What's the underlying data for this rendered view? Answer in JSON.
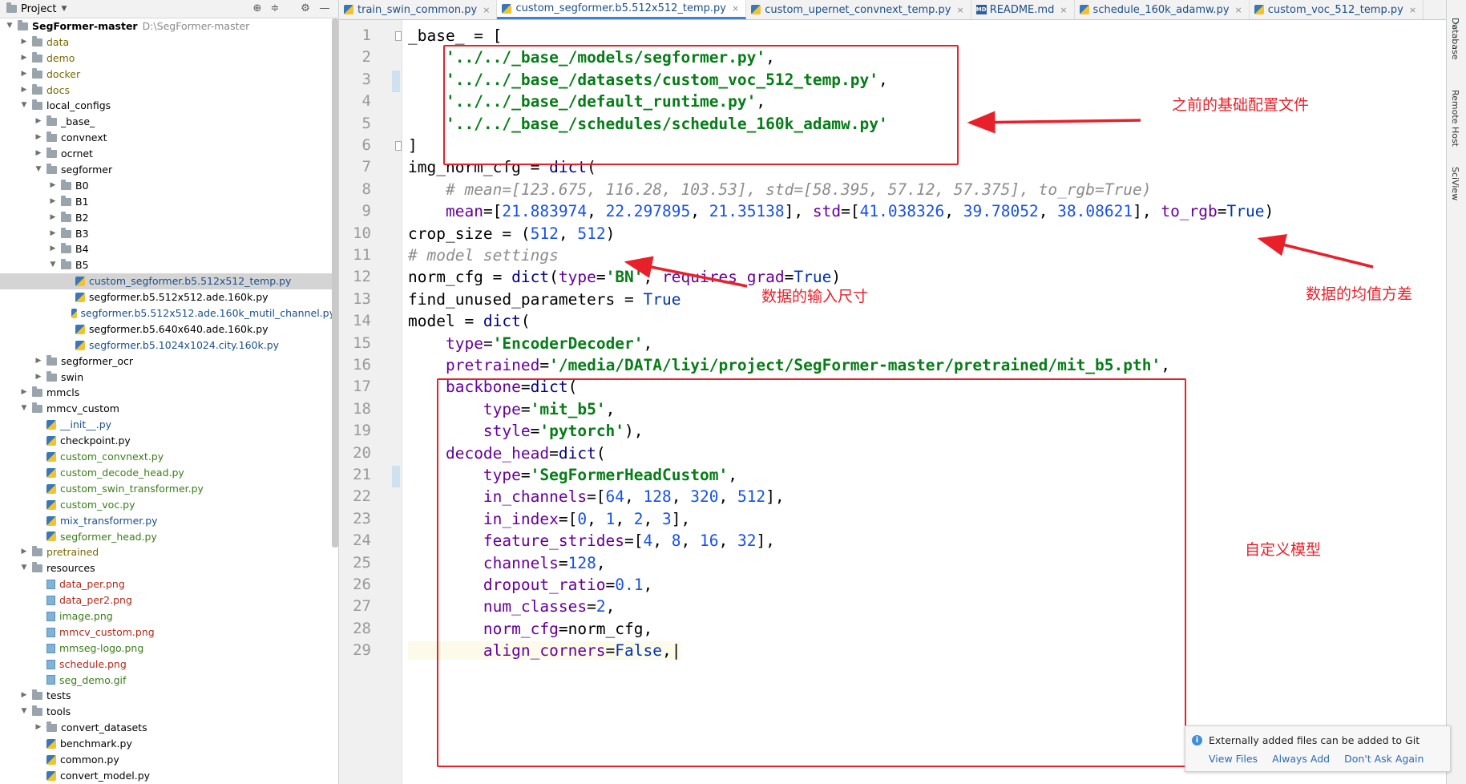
{
  "project": {
    "title": "Project",
    "tree": [
      {
        "label": "SegFormer-master",
        "hint": "D:\\SegFormer-master",
        "indent": 0,
        "type": "folder",
        "state": "open",
        "root": true
      },
      {
        "label": "data",
        "indent": 1,
        "type": "folder",
        "state": "closed",
        "color": "#7a6a00"
      },
      {
        "label": "demo",
        "indent": 1,
        "type": "folder",
        "state": "closed",
        "color": "#7a6a00"
      },
      {
        "label": "docker",
        "indent": 1,
        "type": "folder",
        "state": "closed",
        "color": "#7a6a00"
      },
      {
        "label": "docs",
        "indent": 1,
        "type": "folder",
        "state": "closed",
        "color": "#7a6a00"
      },
      {
        "label": "local_configs",
        "indent": 1,
        "type": "folder",
        "state": "open",
        "color": "#000000"
      },
      {
        "label": "_base_",
        "indent": 2,
        "type": "folder",
        "state": "closed",
        "color": "#000000"
      },
      {
        "label": "convnext",
        "indent": 2,
        "type": "folder",
        "state": "closed",
        "color": "#000000"
      },
      {
        "label": "ocrnet",
        "indent": 2,
        "type": "folder",
        "state": "closed",
        "color": "#000000"
      },
      {
        "label": "segformer",
        "indent": 2,
        "type": "folder",
        "state": "open",
        "color": "#000000"
      },
      {
        "label": "B0",
        "indent": 3,
        "type": "folder",
        "state": "closed",
        "color": "#000000"
      },
      {
        "label": "B1",
        "indent": 3,
        "type": "folder",
        "state": "closed",
        "color": "#000000"
      },
      {
        "label": "B2",
        "indent": 3,
        "type": "folder",
        "state": "closed",
        "color": "#000000"
      },
      {
        "label": "B3",
        "indent": 3,
        "type": "folder",
        "state": "closed",
        "color": "#000000"
      },
      {
        "label": "B4",
        "indent": 3,
        "type": "folder",
        "state": "closed",
        "color": "#000000"
      },
      {
        "label": "B5",
        "indent": 3,
        "type": "folder",
        "state": "open",
        "color": "#000000"
      },
      {
        "label": "custom_segformer.b5.512x512_temp.py",
        "indent": 4,
        "type": "py",
        "color": "#1a4f8b",
        "selected": true
      },
      {
        "label": "segformer.b5.512x512.ade.160k.py",
        "indent": 4,
        "type": "py",
        "color": "#000000"
      },
      {
        "label": "segformer.b5.512x512.ade.160k_mutil_channel.py",
        "indent": 4,
        "type": "py",
        "color": "#1a4f8b"
      },
      {
        "label": "segformer.b5.640x640.ade.160k.py",
        "indent": 4,
        "type": "py",
        "color": "#000000"
      },
      {
        "label": "segformer.b5.1024x1024.city.160k.py",
        "indent": 4,
        "type": "py",
        "color": "#1a4f8b"
      },
      {
        "label": "segformer_ocr",
        "indent": 2,
        "type": "folder",
        "state": "closed",
        "color": "#000000"
      },
      {
        "label": "swin",
        "indent": 2,
        "type": "folder",
        "state": "closed",
        "color": "#000000"
      },
      {
        "label": "mmcls",
        "indent": 1,
        "type": "folder",
        "state": "closed",
        "color": "#000000"
      },
      {
        "label": "mmcv_custom",
        "indent": 1,
        "type": "folder",
        "state": "open",
        "color": "#000000"
      },
      {
        "label": "__init__.py",
        "indent": 2,
        "type": "py",
        "color": "#1a4f8b"
      },
      {
        "label": "checkpoint.py",
        "indent": 2,
        "type": "py",
        "color": "#000000"
      },
      {
        "label": "custom_convnext.py",
        "indent": 2,
        "type": "py",
        "color": "#3a7d1a"
      },
      {
        "label": "custom_decode_head.py",
        "indent": 2,
        "type": "py",
        "color": "#3a7d1a"
      },
      {
        "label": "custom_swin_transformer.py",
        "indent": 2,
        "type": "py",
        "color": "#3a7d1a"
      },
      {
        "label": "custom_voc.py",
        "indent": 2,
        "type": "py",
        "color": "#3a7d1a"
      },
      {
        "label": "mix_transformer.py",
        "indent": 2,
        "type": "py",
        "color": "#1a4f8b"
      },
      {
        "label": "segformer_head.py",
        "indent": 2,
        "type": "py",
        "color": "#3a7d1a"
      },
      {
        "label": "pretrained",
        "indent": 1,
        "type": "folder",
        "state": "closed",
        "color": "#7a6a00"
      },
      {
        "label": "resources",
        "indent": 1,
        "type": "folder",
        "state": "open",
        "color": "#000000"
      },
      {
        "label": "data_per.png",
        "indent": 2,
        "type": "img",
        "color": "#b02a1a"
      },
      {
        "label": "data_per2.png",
        "indent": 2,
        "type": "img",
        "color": "#b02a1a"
      },
      {
        "label": "image.png",
        "indent": 2,
        "type": "img",
        "color": "#3a7d1a"
      },
      {
        "label": "mmcv_custom.png",
        "indent": 2,
        "type": "img",
        "color": "#b02a1a"
      },
      {
        "label": "mmseg-logo.png",
        "indent": 2,
        "type": "img",
        "color": "#3a7d1a"
      },
      {
        "label": "schedule.png",
        "indent": 2,
        "type": "img",
        "color": "#b02a1a"
      },
      {
        "label": "seg_demo.gif",
        "indent": 2,
        "type": "img",
        "color": "#3a7d1a"
      },
      {
        "label": "tests",
        "indent": 1,
        "type": "folder",
        "state": "closed",
        "color": "#000000"
      },
      {
        "label": "tools",
        "indent": 1,
        "type": "folder",
        "state": "open",
        "color": "#000000"
      },
      {
        "label": "convert_datasets",
        "indent": 2,
        "type": "folder",
        "state": "closed",
        "color": "#000000"
      },
      {
        "label": "benchmark.py",
        "indent": 2,
        "type": "py",
        "color": "#000000"
      },
      {
        "label": "common.py",
        "indent": 2,
        "type": "py",
        "color": "#000000"
      },
      {
        "label": "convert_model.py",
        "indent": 2,
        "type": "py",
        "color": "#000000"
      }
    ]
  },
  "tabs": [
    {
      "label": "train_swin_common.py",
      "active": false,
      "icon": "py"
    },
    {
      "label": "custom_segformer.b5.512x512_temp.py",
      "active": true,
      "icon": "py"
    },
    {
      "label": "custom_upernet_convnext_temp.py",
      "active": false,
      "icon": "py"
    },
    {
      "label": "README.md",
      "active": false,
      "icon": "md"
    },
    {
      "label": "schedule_160k_adamw.py",
      "active": false,
      "icon": "py"
    },
    {
      "label": "custom_voc_512_temp.py",
      "active": false,
      "icon": "py"
    }
  ],
  "code": [
    [
      [
        "",
        "_base_ = ["
      ]
    ],
    [
      [
        "",
        "    "
      ],
      [
        "str",
        "'../../_base_/models/segformer.py'"
      ],
      [
        "",
        ","
      ]
    ],
    [
      [
        "",
        "    "
      ],
      [
        "str",
        "'../../_base_/datasets/custom_voc_512_temp.py'"
      ],
      [
        "",
        ","
      ]
    ],
    [
      [
        "",
        "    "
      ],
      [
        "str",
        "'../../_base_/default_runtime.py'"
      ],
      [
        "",
        ","
      ]
    ],
    [
      [
        "",
        "    "
      ],
      [
        "str",
        "'../../_base_/schedules/schedule_160k_adamw.py'"
      ]
    ],
    [
      [
        "",
        "]"
      ]
    ],
    [
      [
        "",
        "img_norm_cfg = "
      ],
      [
        "builtin",
        "dict"
      ],
      [
        "",
        "("
      ]
    ],
    [
      [
        "",
        "    "
      ],
      [
        "com",
        "# mean=[123.675, 116.28, 103.53], std=[58.395, 57.12, 57.375], to_rgb=True)"
      ]
    ],
    [
      [
        "",
        "    "
      ],
      [
        "param",
        "mean"
      ],
      [
        "",
        "=["
      ],
      [
        "num",
        "21.883974"
      ],
      [
        "",
        ", "
      ],
      [
        "num",
        "22.297895"
      ],
      [
        "",
        ", "
      ],
      [
        "num",
        "21.35138"
      ],
      [
        "",
        "], "
      ],
      [
        "param",
        "std"
      ],
      [
        "",
        "=["
      ],
      [
        "num",
        "41.038326"
      ],
      [
        "",
        ", "
      ],
      [
        "num",
        "39.78052"
      ],
      [
        "",
        ", "
      ],
      [
        "num",
        "38.08621"
      ],
      [
        "",
        "], "
      ],
      [
        "param",
        "to_rgb"
      ],
      [
        "",
        "="
      ],
      [
        "bool",
        "True"
      ],
      [
        "",
        ")"
      ]
    ],
    [
      [
        "",
        "crop_size = ("
      ],
      [
        "num",
        "512"
      ],
      [
        "",
        ", "
      ],
      [
        "num",
        "512"
      ],
      [
        "",
        ")"
      ]
    ],
    [
      [
        "com",
        "# model settings"
      ]
    ],
    [
      [
        "",
        "norm_cfg = "
      ],
      [
        "builtin",
        "dict"
      ],
      [
        "",
        "("
      ],
      [
        "param",
        "type"
      ],
      [
        "",
        "="
      ],
      [
        "str",
        "'BN'"
      ],
      [
        "",
        ", "
      ],
      [
        "param",
        "requires_grad"
      ],
      [
        "",
        "="
      ],
      [
        "bool",
        "True"
      ],
      [
        "",
        ")"
      ]
    ],
    [
      [
        "",
        "find_unused_parameters = "
      ],
      [
        "bool",
        "True"
      ]
    ],
    [
      [
        "",
        "model = "
      ],
      [
        "builtin",
        "dict"
      ],
      [
        "",
        "("
      ]
    ],
    [
      [
        "",
        "    "
      ],
      [
        "param",
        "type"
      ],
      [
        "",
        "="
      ],
      [
        "str",
        "'EncoderDecoder'"
      ],
      [
        "",
        ","
      ]
    ],
    [
      [
        "",
        "    "
      ],
      [
        "param",
        "pretrained"
      ],
      [
        "",
        "="
      ],
      [
        "str",
        "'/media/DATA/liyi/project/SegFormer-master/pretrained/mit_b5.pth'"
      ],
      [
        "",
        ","
      ]
    ],
    [
      [
        "",
        "    "
      ],
      [
        "param",
        "backbone"
      ],
      [
        "",
        "="
      ],
      [
        "builtin",
        "dict"
      ],
      [
        "",
        "("
      ]
    ],
    [
      [
        "",
        "        "
      ],
      [
        "param",
        "type"
      ],
      [
        "",
        "="
      ],
      [
        "str",
        "'mit_b5'"
      ],
      [
        "",
        ","
      ]
    ],
    [
      [
        "",
        "        "
      ],
      [
        "param",
        "style"
      ],
      [
        "",
        "="
      ],
      [
        "str",
        "'pytorch'"
      ],
      [
        "",
        "),"
      ]
    ],
    [
      [
        "",
        "    "
      ],
      [
        "param",
        "decode_head"
      ],
      [
        "",
        "="
      ],
      [
        "builtin",
        "dict"
      ],
      [
        "",
        "("
      ]
    ],
    [
      [
        "",
        "        "
      ],
      [
        "param",
        "type"
      ],
      [
        "",
        "="
      ],
      [
        "str",
        "'SegFormerHeadCustom'"
      ],
      [
        "",
        ","
      ]
    ],
    [
      [
        "",
        "        "
      ],
      [
        "param",
        "in_channels"
      ],
      [
        "",
        "=["
      ],
      [
        "num",
        "64"
      ],
      [
        "",
        ", "
      ],
      [
        "num",
        "128"
      ],
      [
        "",
        ", "
      ],
      [
        "num",
        "320"
      ],
      [
        "",
        ", "
      ],
      [
        "num",
        "512"
      ],
      [
        "",
        "],"
      ]
    ],
    [
      [
        "",
        "        "
      ],
      [
        "param",
        "in_index"
      ],
      [
        "",
        "=["
      ],
      [
        "num",
        "0"
      ],
      [
        "",
        ", "
      ],
      [
        "num",
        "1"
      ],
      [
        "",
        ", "
      ],
      [
        "num",
        "2"
      ],
      [
        "",
        ", "
      ],
      [
        "num",
        "3"
      ],
      [
        "",
        "],"
      ]
    ],
    [
      [
        "",
        "        "
      ],
      [
        "param",
        "feature_strides"
      ],
      [
        "",
        "=["
      ],
      [
        "num",
        "4"
      ],
      [
        "",
        ", "
      ],
      [
        "num",
        "8"
      ],
      [
        "",
        ", "
      ],
      [
        "num",
        "16"
      ],
      [
        "",
        ", "
      ],
      [
        "num",
        "32"
      ],
      [
        "",
        "],"
      ]
    ],
    [
      [
        "",
        "        "
      ],
      [
        "param",
        "channels"
      ],
      [
        "",
        "="
      ],
      [
        "num",
        "128"
      ],
      [
        "",
        ","
      ]
    ],
    [
      [
        "",
        "        "
      ],
      [
        "param",
        "dropout_ratio"
      ],
      [
        "",
        "="
      ],
      [
        "num",
        "0.1"
      ],
      [
        "",
        ","
      ]
    ],
    [
      [
        "",
        "        "
      ],
      [
        "param",
        "num_classes"
      ],
      [
        "",
        "="
      ],
      [
        "num",
        "2"
      ],
      [
        "",
        ","
      ]
    ],
    [
      [
        "",
        "        "
      ],
      [
        "param",
        "norm_cfg"
      ],
      [
        "",
        "=norm_cfg,"
      ]
    ],
    [
      [
        "",
        "        "
      ],
      [
        "param",
        "align_corners"
      ],
      [
        "",
        "="
      ],
      [
        "bool",
        "False"
      ],
      [
        "",
        ",|"
      ]
    ]
  ],
  "annotations": {
    "base_config": "之前的基础配置文件",
    "input_size": "数据的输入尺寸",
    "mean_std": "数据的均值方差",
    "custom_model": "自定义模型"
  },
  "right_strip": {
    "database": "Database",
    "remote_host": "Remote Host",
    "sciview": "SciView"
  },
  "notification": {
    "message": "Externally added files can be added to Git",
    "view_files": "View Files",
    "always_add": "Always Add",
    "dont_ask": "Don't Ask Again"
  },
  "colors": {
    "annotation": "#e8202a",
    "string": "#067d17",
    "number": "#1750eb",
    "keyword": "#000080",
    "param": "#660099"
  }
}
